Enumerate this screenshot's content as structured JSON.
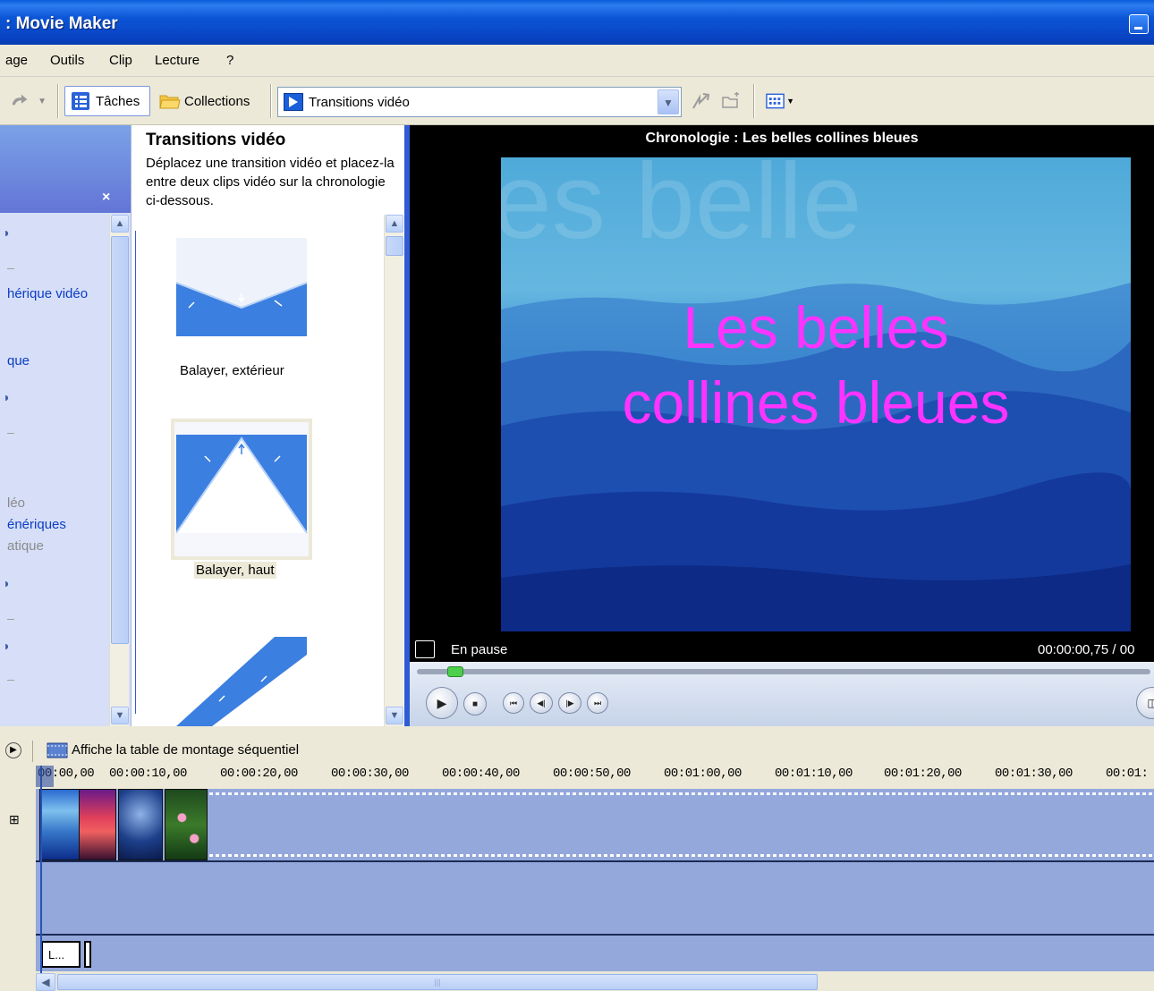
{
  "window": {
    "title": ": Movie Maker"
  },
  "menu": {
    "items": [
      "age",
      "Outils",
      "Clip",
      "Lecture",
      "?"
    ]
  },
  "toolbar": {
    "tasks_label": "Tâches",
    "collections_label": "Collections",
    "collection_select": "Transitions vidéo"
  },
  "task_pane": {
    "items": [
      "hérique vidéo",
      "que",
      "léo",
      "énériques",
      "atique"
    ]
  },
  "collection_pane": {
    "title": "Transitions vidéo",
    "description": "Déplacez une transition vidéo et placez-la entre deux clips vidéo sur la chronologie ci-dessous.",
    "transitions": [
      {
        "label": "Balayer, extérieur",
        "selected": false
      },
      {
        "label": "Balayer, haut",
        "selected": true
      },
      {
        "label": "",
        "selected": false
      }
    ]
  },
  "monitor": {
    "header": "Chronologie : Les belles collines bleues",
    "preview_text_line1": "Les belles",
    "preview_text_line2": "collines bleues",
    "watermark": "es belle",
    "status": "En pause",
    "time": "00:00:00,75 / 00"
  },
  "timeline": {
    "toggle_label": "Affiche la table de montage séquentiel",
    "ruler": [
      "00:00,00",
      "00:00:10,00",
      "00:00:20,00",
      "00:00:30,00",
      "00:00:40,00",
      "00:00:50,00",
      "00:01:00,00",
      "00:01:10,00",
      "00:01:20,00",
      "00:01:30,00",
      "00:01:"
    ],
    "title_clip_label": "L...",
    "expand_symbol": "⊞",
    "clips": [
      "clip-blue-hills",
      "clip-red-sunset",
      "clip-blue-water",
      "clip-water-lilies"
    ]
  }
}
